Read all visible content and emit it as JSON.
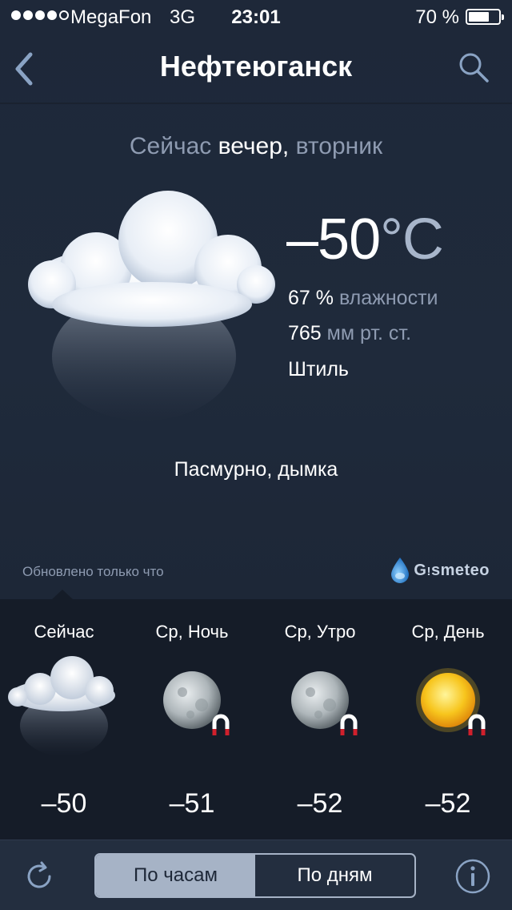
{
  "status_bar": {
    "carrier": "MegaFon",
    "network": "3G",
    "time": "23:01",
    "battery_text": "70 %",
    "battery_level": 0.7,
    "signal_bars_filled": 4,
    "signal_bars_total": 5
  },
  "nav": {
    "title": "Нефтеюганск",
    "back_icon": "chevron-left-icon",
    "search_icon": "search-icon"
  },
  "current": {
    "period_prefix": "Сейчас",
    "period_time": "вечер,",
    "period_day": "вторник",
    "icon": "cloud-haze-icon",
    "temperature": "–50",
    "temperature_unit": "°C",
    "humidity_value": "67 %",
    "humidity_label": "влажности",
    "pressure_value": "765",
    "pressure_label": "мм рт. ст.",
    "wind": "Штиль",
    "condition": "Пасмурно, дымка",
    "updated": "Обновлено только что",
    "provider": "Gismeteo"
  },
  "forecast": [
    {
      "label": "Сейчас",
      "icon": "cloud-haze-icon",
      "temp": "–50"
    },
    {
      "label": "Ср, Ночь",
      "icon": "moon-frost-icon",
      "temp": "–51"
    },
    {
      "label": "Ср, Утро",
      "icon": "moon-frost-icon",
      "temp": "–52"
    },
    {
      "label": "Ср, День",
      "icon": "sun-frost-icon",
      "temp": "–52"
    }
  ],
  "toolbar": {
    "refresh_icon": "refresh-icon",
    "tab_hourly": "По часам",
    "tab_daily": "По дням",
    "active_tab": "hourly",
    "info_icon": "info-icon"
  },
  "colors": {
    "background": "#1e2839",
    "muted_text": "#8e9bb1",
    "forecast_bg": "#151c28",
    "segment_active": "#a6b3c6",
    "toolbar_bg": "#232e3f"
  }
}
